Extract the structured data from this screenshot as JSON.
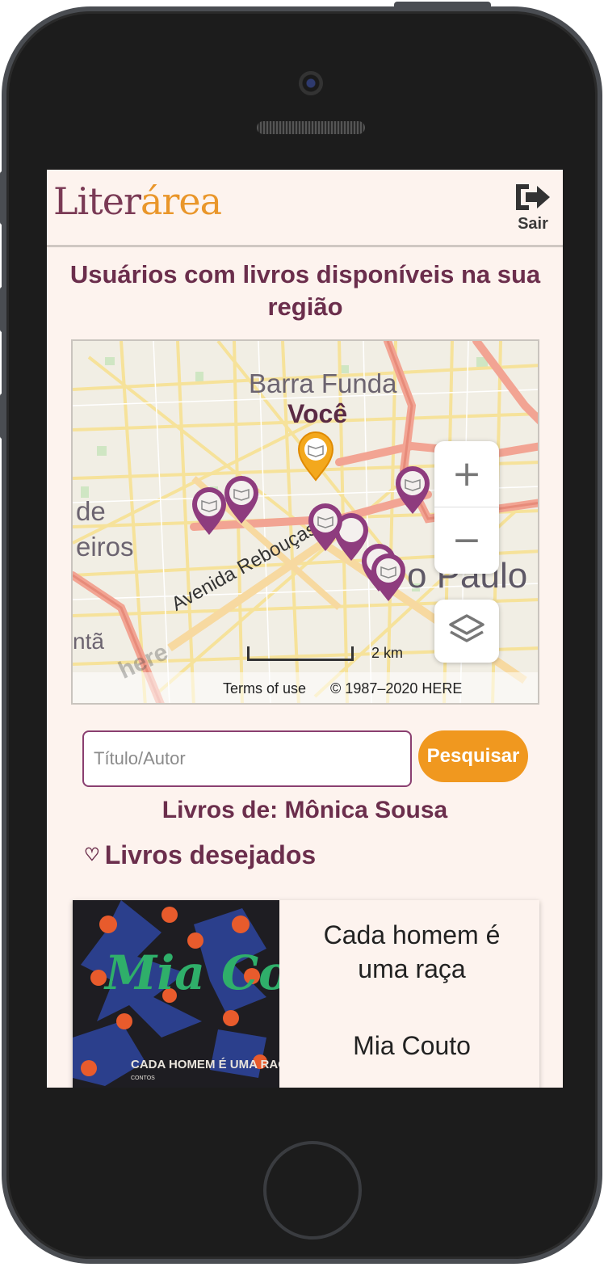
{
  "app": {
    "logo_part1": "Liter",
    "logo_part2": "área",
    "logout_label": "Sair",
    "logout_icon": "sign-out-icon"
  },
  "map_section": {
    "title": "Usuários com livros disponíveis na sua região",
    "labels": {
      "district": "Barra Funda",
      "you": "Você",
      "partial_left_1": "de",
      "partial_left_2": "eiros",
      "partial_left_3": "ntã",
      "city": "o Paulo",
      "street": "Avenida Rebouças",
      "watermark": "here"
    },
    "zoom_in": "+",
    "zoom_out": "−",
    "layers_icon": "layers-icon",
    "scale_label": "2 km",
    "terms": "Terms of use",
    "copyright": "© 1987–2020 HERE"
  },
  "search": {
    "placeholder": "Título/Autor",
    "value": "",
    "button_label": "Pesquisar"
  },
  "owner": {
    "title": "Livros de: Mônica Sousa"
  },
  "wishlist": {
    "heart_icon": "♡",
    "title": "Livros desejados",
    "books": [
      {
        "title": "Cada homem é uma raça",
        "author": "Mia Couto",
        "cover_text_author": "Mia Couto",
        "cover_text_title": "CADA HOMEM É UMA RAÇA",
        "cover_text_sub": "CONTOS"
      }
    ]
  },
  "colors": {
    "brand_purple": "#7a3a55",
    "brand_orange": "#e9962a",
    "heading": "#6b2e4c",
    "button": "#f0981f",
    "screen_bg": "#fdf3ee"
  }
}
